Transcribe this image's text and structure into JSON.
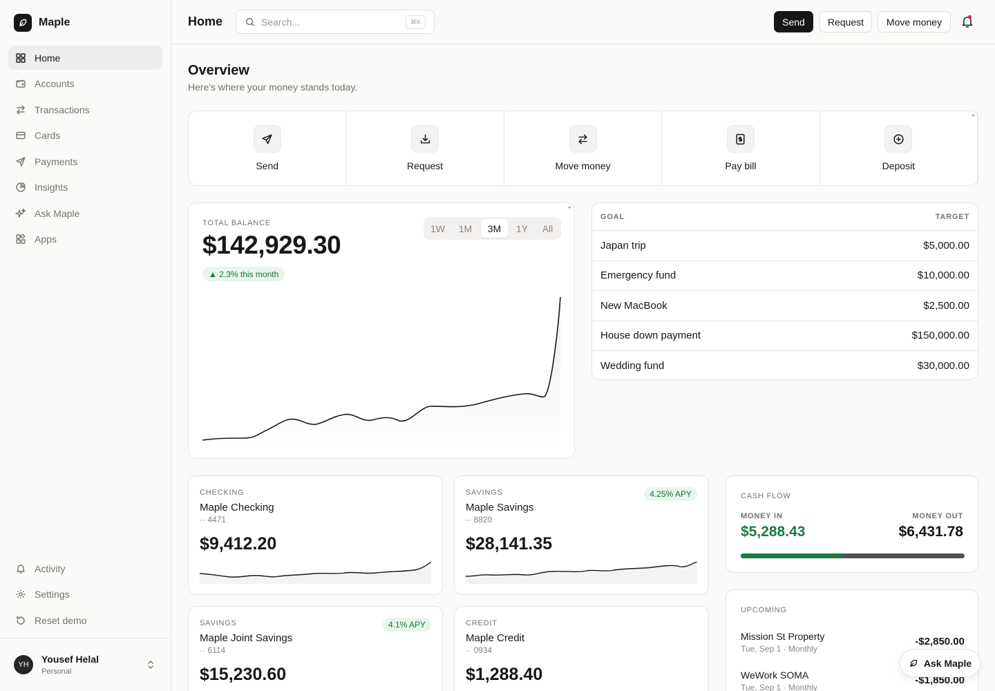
{
  "app": {
    "name": "Maple"
  },
  "sidebar": {
    "items": [
      {
        "label": "Home",
        "icon": "grid-icon"
      },
      {
        "label": "Accounts",
        "icon": "wallet-icon"
      },
      {
        "label": "Transactions",
        "icon": "arrows-icon"
      },
      {
        "label": "Cards",
        "icon": "card-icon"
      },
      {
        "label": "Payments",
        "icon": "send-icon"
      },
      {
        "label": "Insights",
        "icon": "pie-icon"
      },
      {
        "label": "Ask Maple",
        "icon": "sparkles-icon"
      },
      {
        "label": "Apps",
        "icon": "apps-icon"
      }
    ],
    "active": "Home",
    "bottom": [
      {
        "label": "Activity",
        "icon": "bell-icon"
      },
      {
        "label": "Settings",
        "icon": "gear-icon"
      },
      {
        "label": "Reset demo",
        "icon": "reset-icon"
      }
    ],
    "user": {
      "initials": "YH",
      "name": "Yousef Helal",
      "plan": "Personal"
    }
  },
  "topbar": {
    "title": "Home",
    "search_placeholder": "Search...",
    "search_shortcut": "⌘K",
    "send": "Send",
    "request": "Request",
    "move_money": "Move money"
  },
  "overview": {
    "title": "Overview",
    "subtitle": "Here's where your money stands today."
  },
  "quick_actions": [
    {
      "label": "Send",
      "icon": "send-icon"
    },
    {
      "label": "Request",
      "icon": "download-icon"
    },
    {
      "label": "Move money",
      "icon": "arrows-icon"
    },
    {
      "label": "Pay bill",
      "icon": "bill-icon"
    },
    {
      "label": "Deposit",
      "icon": "plus-circle-icon"
    }
  ],
  "balance": {
    "label": "TOTAL BALANCE",
    "amount": "$142,929.30",
    "change": "▲ 2.3% this month",
    "ranges": [
      "1W",
      "1M",
      "3M",
      "1Y",
      "All"
    ],
    "active_range": "3M"
  },
  "goals": {
    "header_goal": "GOAL",
    "header_target": "TARGET",
    "rows": [
      {
        "name": "Japan trip",
        "target": "$5,000.00"
      },
      {
        "name": "Emergency fund",
        "target": "$10,000.00"
      },
      {
        "name": "New MacBook",
        "target": "$2,500.00"
      },
      {
        "name": "House down payment",
        "target": "$150,000.00"
      },
      {
        "name": "Wedding fund",
        "target": "$30,000.00"
      }
    ]
  },
  "accounts": [
    {
      "type": "CHECKING",
      "name": "Maple Checking",
      "number": "·· 4471",
      "balance": "$9,412.20",
      "apy": ""
    },
    {
      "type": "SAVINGS",
      "name": "Maple Savings",
      "number": "·· 8820",
      "balance": "$28,141.35",
      "apy": "4.25% APY"
    },
    {
      "type": "SAVINGS",
      "name": "Maple Joint Savings",
      "number": "·· 6114",
      "balance": "$15,230.60",
      "apy": "4.1% APY"
    },
    {
      "type": "CREDIT",
      "name": "Maple Credit",
      "number": "·· 0934",
      "balance": "$1,288.40",
      "apy": ""
    }
  ],
  "cash_flow": {
    "title": "CASH FLOW",
    "in_label": "MONEY IN",
    "out_label": "MONEY OUT",
    "money_in": "$5,288.43",
    "money_out": "$6,431.78",
    "in_share": 0.451
  },
  "upcoming": {
    "title": "UPCOMING",
    "rows": [
      {
        "name": "Mission St Property",
        "meta": "Tue, Sep 1 · Monthly",
        "amount": "-$2,850.00"
      },
      {
        "name": "WeWork SOMA",
        "meta": "Tue, Sep 1 · Monthly",
        "amount": "-$1,850.00"
      }
    ]
  },
  "ask_button": "Ask Maple",
  "colors": {
    "accent": "#171717",
    "positive": "#1c7a45",
    "notification": "#e11d48"
  }
}
